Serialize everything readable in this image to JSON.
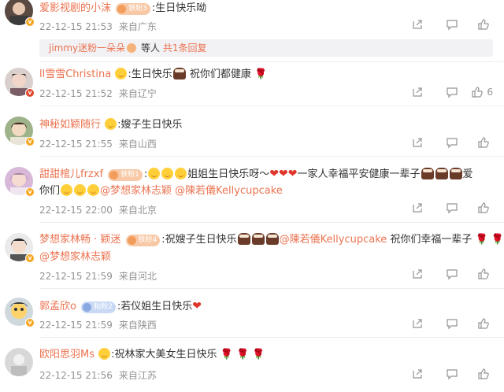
{
  "comments": [
    {
      "username": "爱影视剧的小沫",
      "badge": "铁粉3",
      "text": ":生日快乐呦",
      "time": "22-12-15 21:53",
      "location": "来自广东",
      "likes": "",
      "reply": {
        "name": "jimmy迷粉一朵朵",
        "mid": "等人",
        "link": "共1条回复"
      }
    },
    {
      "username": "ll雪雪Christina",
      "badge": "",
      "text_a": ":生日快乐",
      "text_b": "祝你们都健康",
      "time": "22-12-15 21:52",
      "location": "来自辽宁",
      "likes": "6"
    },
    {
      "username": "神秘如颖随行",
      "badge": "",
      "text": ":嫂子生日快乐",
      "time": "22-12-15 21:55",
      "location": "来自山西",
      "likes": ""
    },
    {
      "username": "甜甜棺儿frzxf",
      "badge": "铁粉1",
      "text_a": "姐姐生日快乐呀～",
      "text_b": "一家人幸福平安健康一辈子",
      "text_c": "爱",
      "text_d": "你们",
      "mention1": "@梦想家林志颖",
      "mention2": "@陳若儀Kellycupcake",
      "time": "22-12-15 22:00",
      "location": "来自北京",
      "likes": ""
    },
    {
      "username": "梦想家林畅 · 颖迷",
      "badge": "铁粉4",
      "text_a": ":祝嫂子生日快乐",
      "mention1": "@陳若儀Kellycupcake",
      "text_b": "祝你们幸福一辈子",
      "mention2": "@梦想家林志颖",
      "time": "22-12-15 21:59",
      "location": "来自河北",
      "likes": ""
    },
    {
      "username": "郭孟欣o",
      "badge": "粘粉2",
      "text": ":若仪姐生日快乐",
      "time": "22-12-15 21:59",
      "location": "来自陕西",
      "likes": ""
    },
    {
      "username": "欧阳思羽Ms",
      "badge": "",
      "text": ":祝林家大美女生日快乐",
      "time": "22-12-15 21:56",
      "location": "来自江苏",
      "likes": ""
    }
  ],
  "icons": {
    "share": "share-icon",
    "comment": "comment-icon",
    "like": "thumbs-up-icon"
  },
  "colors": {
    "username": "#eb7350",
    "meta": "#939393",
    "reply_bg": "#f2f2f5"
  }
}
